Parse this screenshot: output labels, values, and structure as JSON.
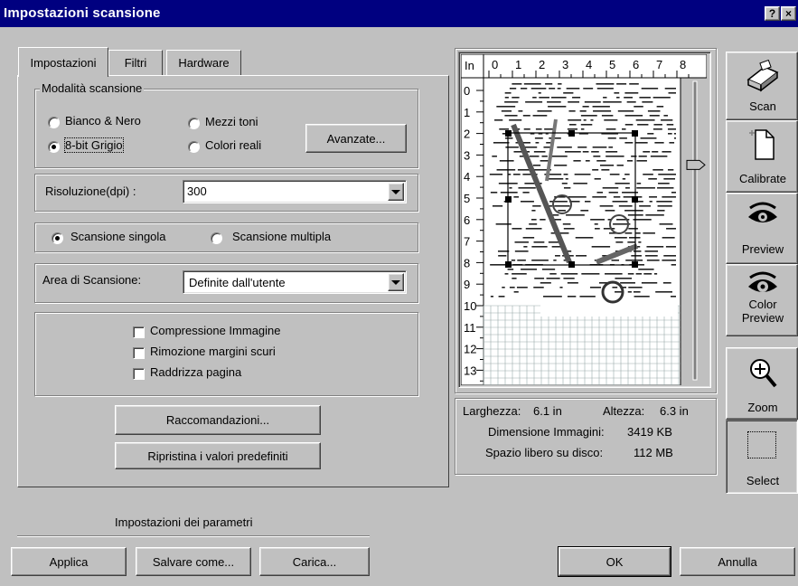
{
  "window": {
    "title": "Impostazioni scansione",
    "help_label": "?",
    "close_label": "×"
  },
  "tabs": [
    {
      "label": "Impostazioni",
      "active": true
    },
    {
      "label": "Filtri",
      "active": false
    },
    {
      "label": "Hardware",
      "active": false
    }
  ],
  "mode_group": {
    "label": "Modalità scansione",
    "options": [
      {
        "label": "Bianco & Nero",
        "selected": false
      },
      {
        "label": "Mezzi toni",
        "selected": false
      },
      {
        "label": "8-bit Grigio",
        "selected": true
      },
      {
        "label": "Colori reali",
        "selected": false
      }
    ],
    "advanced_button": "Avanzate..."
  },
  "resolution": {
    "label": "Risoluzione(dpi) :",
    "value": "300"
  },
  "scan_type": {
    "single": "Scansione singola",
    "multiple": "Scansione multipla",
    "selected": "single"
  },
  "scan_area": {
    "label": "Area di Scansione:",
    "value": "Definite dall'utente"
  },
  "options": [
    {
      "label": "Compressione Immagine",
      "checked": false
    },
    {
      "label": "Rimozione margini scuri",
      "checked": false
    },
    {
      "label": "Raddrizza pagina",
      "checked": false
    }
  ],
  "buttons": {
    "recommendations": "Raccomandazioni...",
    "restore_defaults": "Ripristina i valori predefiniti",
    "apply": "Applica",
    "save_as": "Salvare come...",
    "load": "Carica...",
    "ok": "OK",
    "cancel": "Annulla"
  },
  "params_label": "Impostazioni dei parametri",
  "preview": {
    "unit": "In",
    "h_ticks": [
      "0",
      "1",
      "2",
      "3",
      "4",
      "5",
      "6",
      "7",
      "8"
    ],
    "v_ticks": [
      "0",
      "1",
      "2",
      "3",
      "4",
      "5",
      "6",
      "7",
      "8",
      "9",
      "10",
      "11",
      "12",
      "13"
    ],
    "slider_level": 0.72
  },
  "info": {
    "width_label": "Larghezza:",
    "width_value": "6.1 in",
    "height_label": "Altezza:",
    "height_value": "6.3 in",
    "size_label": "Dimensione Immagini:",
    "size_value": "3419 KB",
    "disk_label": "Spazio libero su disco:",
    "disk_value": "112 MB"
  },
  "tools": [
    {
      "label": "Scan",
      "icon": "scanner-icon"
    },
    {
      "label": "Calibrate",
      "icon": "calibrate-icon"
    },
    {
      "label": "Preview",
      "icon": "eye-icon"
    },
    {
      "label": "Color\nPreview",
      "icon": "color-eye-icon"
    },
    {
      "label": "Zoom",
      "icon": "magnifier-icon"
    },
    {
      "label": "Select",
      "icon": "select-icon"
    }
  ]
}
